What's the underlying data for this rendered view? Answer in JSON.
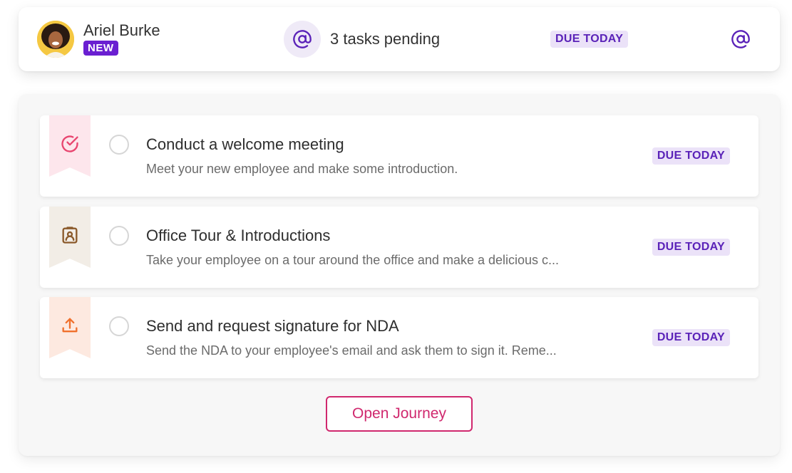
{
  "header": {
    "user_name": "Ariel Burke",
    "new_badge": "NEW",
    "tasks_pending": "3 tasks pending",
    "due_badge": "DUE TODAY",
    "icons": [
      "at-sign-icon",
      "at-sign-icon"
    ]
  },
  "tasks": [
    {
      "title": "Conduct a welcome meeting",
      "description": "Meet your new employee and make some introduction.",
      "due": "DUE TODAY",
      "icon": "check-circle-icon",
      "ribbon_color": "#fde6ec",
      "icon_color": "#e8456f"
    },
    {
      "title": "Office Tour & Introductions",
      "description": "Take your employee on a tour around the office and make a delicious c...",
      "due": "DUE TODAY",
      "icon": "id-badge-icon",
      "ribbon_color": "#f2ede6",
      "icon_color": "#8b5a2b"
    },
    {
      "title": "Send and request signature for NDA",
      "description": "Send the NDA to your employee's email and ask them to sign it. Reme...",
      "due": "DUE TODAY",
      "icon": "upload-icon",
      "ribbon_color": "#fde9e0",
      "icon_color": "#f0702c"
    }
  ],
  "footer": {
    "open_journey_label": "Open Journey"
  },
  "colors": {
    "accent_purple": "#6a1fd1",
    "badge_bg": "#ebe2f8",
    "badge_text": "#5a22b8",
    "button_pink": "#d0286e"
  }
}
